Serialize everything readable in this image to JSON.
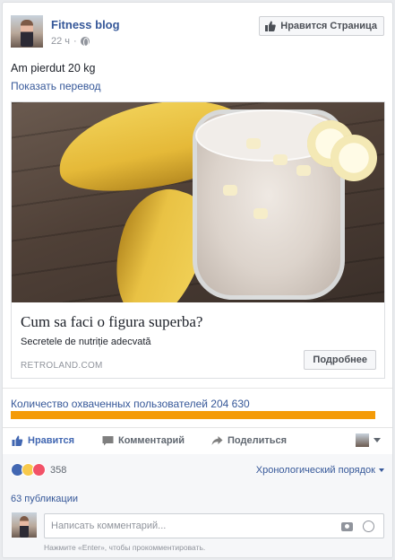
{
  "post": {
    "page_name": "Fitness blog",
    "time": "22 ч",
    "like_page_label": "Нравится Страница",
    "text": "Am pierdut 20 kg",
    "translate_label": "Показать перевод"
  },
  "link": {
    "title": "Cum sa faci o figura superba?",
    "description": "Secretele de nutriție adecvată",
    "domain": "RETROLAND.COM",
    "button_label": "Подробнее"
  },
  "reach": {
    "label": "Количество охваченных пользователей 204 630",
    "progress": 1.0,
    "bar_color": "#f49b08"
  },
  "actions": {
    "like": "Нравится",
    "comment": "Комментарий",
    "share": "Поделиться"
  },
  "reactions": {
    "count": "358",
    "order_label": "Хронологический порядок"
  },
  "shares_label": "63 публикации",
  "comment": {
    "placeholder": "Написать комментарий...",
    "hint": "Нажмите «Enter», чтобы прокомментировать."
  },
  "colors": {
    "link_blue": "#365899",
    "like_blue": "#4267b2",
    "reach_orange": "#f49b08"
  }
}
